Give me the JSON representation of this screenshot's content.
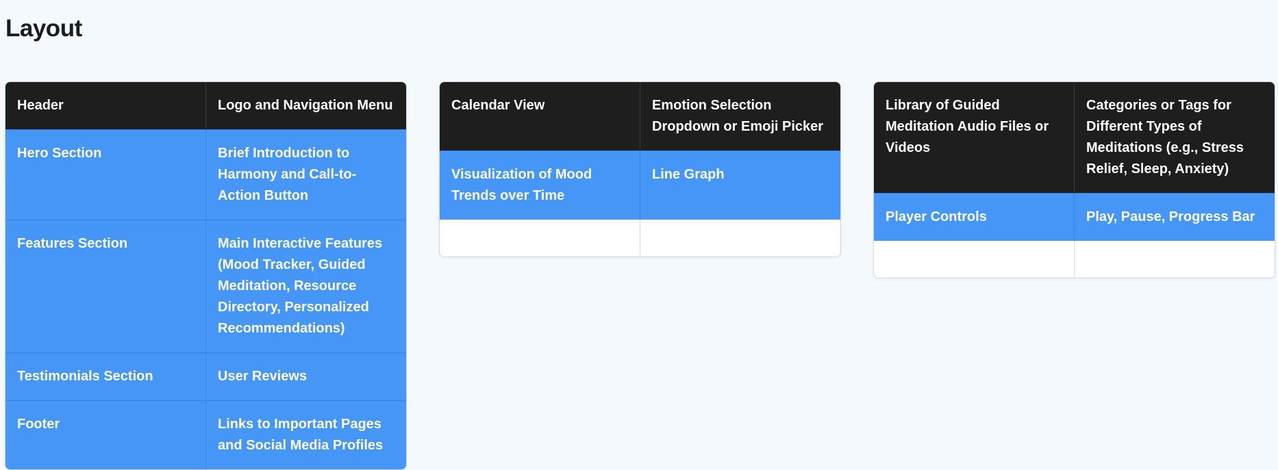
{
  "page": {
    "title": "Layout"
  },
  "cards": [
    {
      "header": [
        "Header",
        "Logo and Navigation Menu"
      ],
      "rows": [
        [
          "Hero Section",
          "Brief Introduction to Harmony and Call-to-Action Button"
        ],
        [
          "Features Section",
          "Main Interactive Features (Mood Tracker, Guided Meditation, Resource Directory, Personalized Recommendations)"
        ],
        [
          "Testimonials Section",
          "User Reviews"
        ],
        [
          "Footer",
          "Links to Important Pages and Social Media Profiles"
        ]
      ]
    },
    {
      "header": [
        "Calendar View",
        "Emotion Selection Dropdown or Emoji Picker"
      ],
      "rows": [
        [
          "Visualization of Mood Trends over Time",
          "Line Graph"
        ]
      ]
    },
    {
      "header": [
        "Library of Guided Meditation Audio Files or Videos",
        "Categories or Tags for Different Types of Meditations (e.g., Stress Relief, Sleep, Anxiety)"
      ],
      "rows": [
        [
          "Player Controls",
          "Play, Pause, Progress Bar"
        ]
      ]
    }
  ],
  "colors": {
    "background": "#f4f9fe",
    "header_row": "#1e1e1e",
    "body_row": "#4596f6",
    "text_dark": "#1c1c1c",
    "text_light": "#ffffff"
  }
}
